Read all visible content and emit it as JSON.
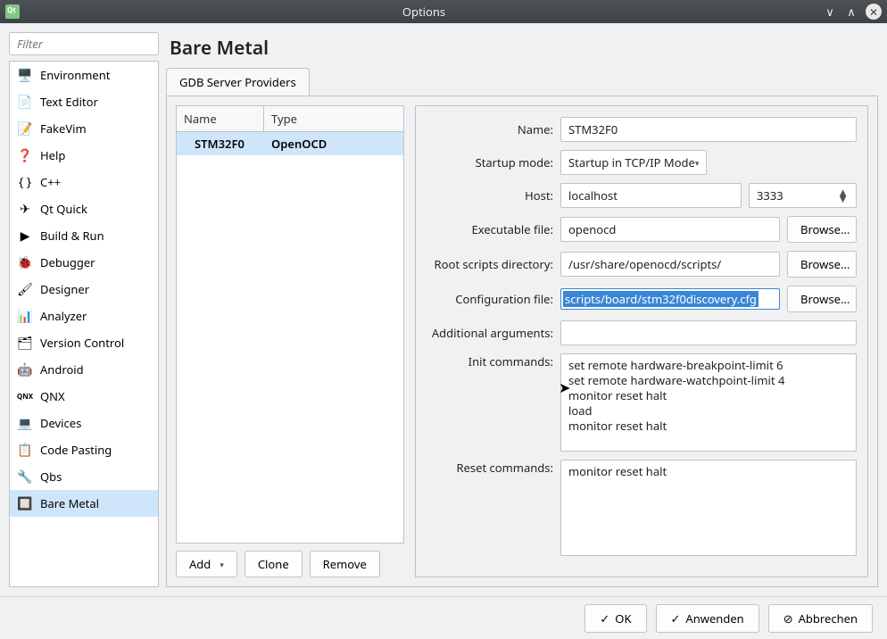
{
  "window": {
    "title": "Options"
  },
  "filter_placeholder": "Filter",
  "categories": [
    {
      "label": "Environment",
      "icon": "🖥️"
    },
    {
      "label": "Text Editor",
      "icon": "📄"
    },
    {
      "label": "FakeVim",
      "icon": "📝"
    },
    {
      "label": "Help",
      "icon": "❓"
    },
    {
      "label": "C++",
      "icon": "{ }"
    },
    {
      "label": "Qt Quick",
      "icon": "✈"
    },
    {
      "label": "Build & Run",
      "icon": "▶"
    },
    {
      "label": "Debugger",
      "icon": "🐞"
    },
    {
      "label": "Designer",
      "icon": "🖌"
    },
    {
      "label": "Analyzer",
      "icon": "📊"
    },
    {
      "label": "Version Control",
      "icon": "🗂"
    },
    {
      "label": "Android",
      "icon": "🤖"
    },
    {
      "label": "QNX",
      "icon": "QNX"
    },
    {
      "label": "Devices",
      "icon": "💻"
    },
    {
      "label": "Code Pasting",
      "icon": "📋"
    },
    {
      "label": "Qbs",
      "icon": "🔧"
    },
    {
      "label": "Bare Metal",
      "icon": "🔲",
      "selected": true
    }
  ],
  "page_heading": "Bare Metal",
  "tab": "GDB Server Providers",
  "table": {
    "col_name": "Name",
    "col_type": "Type",
    "row_name": "STM32F0",
    "row_type": "OpenOCD"
  },
  "provider_btns": {
    "add": "Add",
    "clone": "Clone",
    "remove": "Remove"
  },
  "form": {
    "name_label": "Name:",
    "name_value": "STM32F0",
    "startup_label": "Startup mode:",
    "startup_value": "Startup in TCP/IP Mode",
    "host_label": "Host:",
    "host_value": "localhost",
    "port_value": "3333",
    "exe_label": "Executable file:",
    "exe_value": "openocd",
    "root_label": "Root scripts directory:",
    "root_value": "/usr/share/openocd/scripts/",
    "cfg_label": "Configuration file:",
    "cfg_value": "scripts/board/stm32f0discovery.cfg",
    "addarg_label": "Additional arguments:",
    "addarg_value": "",
    "init_label": "Init commands:",
    "init_value": "set remote hardware-breakpoint-limit 6\nset remote hardware-watchpoint-limit 4\nmonitor reset halt\nload\nmonitor reset halt",
    "reset_label": "Reset commands:",
    "reset_value": "monitor reset halt",
    "browse": "Browse..."
  },
  "dialog": {
    "ok": "OK",
    "apply": "Anwenden",
    "cancel": "Abbrechen"
  }
}
